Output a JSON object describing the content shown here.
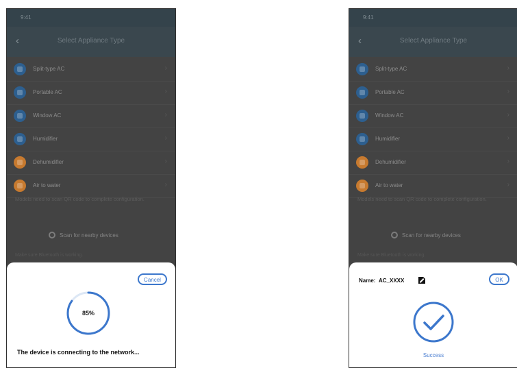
{
  "colors": {
    "accent": "#3c77cc",
    "overlay_bg": "#434343",
    "orange": "#c77a2f",
    "blue": "#2d5f8f"
  },
  "screen": {
    "status_time": "9:41",
    "title": "Select Appliance Type",
    "items": [
      {
        "label": "Split-type AC",
        "icon": "split-ac-icon",
        "color": "#2d5f8f"
      },
      {
        "label": "Portable AC",
        "icon": "portable-ac-icon",
        "color": "#2d5f8f"
      },
      {
        "label": "Window AC",
        "icon": "window-ac-icon",
        "color": "#2d5f8f"
      },
      {
        "label": "Humidifier",
        "icon": "humidifier-icon",
        "color": "#2d5f8f"
      },
      {
        "label": "Dehumidifier",
        "icon": "dehumidifier-icon",
        "color": "#c77a2f"
      },
      {
        "label": "Air to water",
        "icon": "air-to-water-icon",
        "color": "#c77a2f"
      }
    ],
    "note": "Models need to scan QR code to complete configuration.",
    "scan_label": "Scan for nearby devices",
    "bluetooth_note": "Make sure Bluetooth is working."
  },
  "left": {
    "cancel_label": "Cancel",
    "progress_percent": 85,
    "progress_text": "85%",
    "status_text": "The device is connecting to the network..."
  },
  "right": {
    "name_label": "Name:",
    "name_value": "AC_XXXX",
    "ok_label": "OK",
    "success_text": "Success"
  }
}
